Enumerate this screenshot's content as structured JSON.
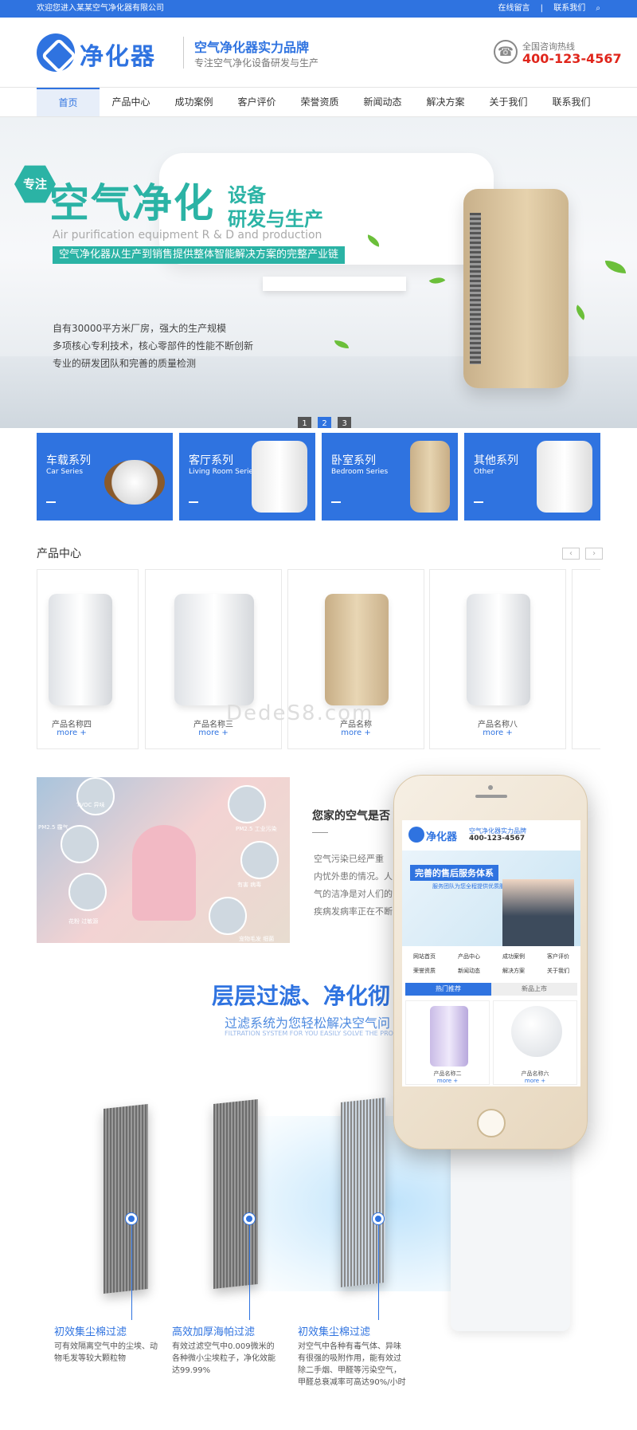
{
  "topbar": {
    "welcome": "欢迎您进入某某空气净化器有限公司",
    "message": "在线留言",
    "sep": "|",
    "contact": "联系我们"
  },
  "header": {
    "logo": "净化器",
    "slogan_title": "空气净化器实力品牌",
    "slogan_sub": "专注空气净化设备研发与生产",
    "hotline_label": "全国咨询热线",
    "hotline": "400-123-4567"
  },
  "nav": [
    "首页",
    "产品中心",
    "成功案例",
    "客户评价",
    "荣誉资质",
    "新闻动态",
    "解决方案",
    "关于我们",
    "联系我们"
  ],
  "banner": {
    "badge": "专注",
    "title": "空气净化",
    "title2": "设备",
    "title3": "研发与生产",
    "english": "Air purification equipment R & D and production",
    "strip": "空气净化器从生产到销售提供整体智能解决方案的完整产业链",
    "lines": [
      "自有30000平方米厂房，强大的生产规模",
      "多项核心专利技术，核心零部件的性能不断创新",
      "专业的研发团队和完善的质量检测"
    ],
    "dots": [
      "1",
      "2",
      "3"
    ]
  },
  "series": [
    {
      "title": "车载系列",
      "en": "Car Series"
    },
    {
      "title": "客厅系列",
      "en": "Living Room Series"
    },
    {
      "title": "卧室系列",
      "en": "Bedroom Series"
    },
    {
      "title": "其他系列",
      "en": "Other"
    }
  ],
  "products": {
    "title": "产品中心",
    "prev": "‹",
    "next": "›",
    "more": "more +",
    "items": [
      "产品名称四",
      "产品名称三",
      "产品名称",
      "产品名称八"
    ]
  },
  "watermark": "DedeS8.com",
  "air": {
    "title": "您家的空气是否",
    "lines": [
      "空气污染已经严重",
      "内忧外患的情况。人",
      "气的洁净是对人们的",
      "疾病发病率正在不断"
    ],
    "labels": [
      "TVOC 异味",
      "PM2.5 霾气",
      "PM2.5 工业污染",
      "花粉 过敏源",
      "有害 病毒",
      "宠物毛发 细菌"
    ]
  },
  "filter": {
    "title": "层层过滤、净化彻",
    "sub": "过滤系统为您轻松解决空气问",
    "en": "FILTRATION SYSTEM FOR YOU EASILY SOLVE THE PROBLEM",
    "cols": [
      {
        "title": "初效集尘棉过滤",
        "text": [
          "可有效隔离空气中的尘埃、动",
          "物毛发等较大颗粒物"
        ]
      },
      {
        "title": "高效加厚海帕过滤",
        "text": [
          "有效过滤空气中0.009微米的",
          "各种微小尘埃粒子，净化效能",
          "达99.99%"
        ]
      },
      {
        "title": "初效集尘棉过滤",
        "text": [
          "对空气中各种有毒气体、异味",
          "有很强的吸附作用，能有效过",
          "除二手烟、甲醛等污染空气，",
          "甲醛总衰减率可高达90%/小时"
        ]
      }
    ]
  },
  "phone": {
    "logo": "净化器",
    "t1": "空气净化器实力品牌",
    "t2": "400-123-4567",
    "banner_title": "完善的售后服务体系",
    "banner_sub": "服务团队为您全程提供优质服务",
    "nav1": [
      "网站首页",
      "产品中心",
      "成功案例",
      "客户评价"
    ],
    "nav2": [
      "荣誉资质",
      "新闻动态",
      "解决方案",
      "关于我们"
    ],
    "tabs": [
      "热门推荐",
      "新品上市"
    ],
    "prods": [
      "产品名称二",
      "产品名称六"
    ],
    "more": "more +"
  },
  "colors": {
    "brand": "#2f73e0",
    "teal": "#2bb3a5",
    "hotline": "#e0261c"
  }
}
